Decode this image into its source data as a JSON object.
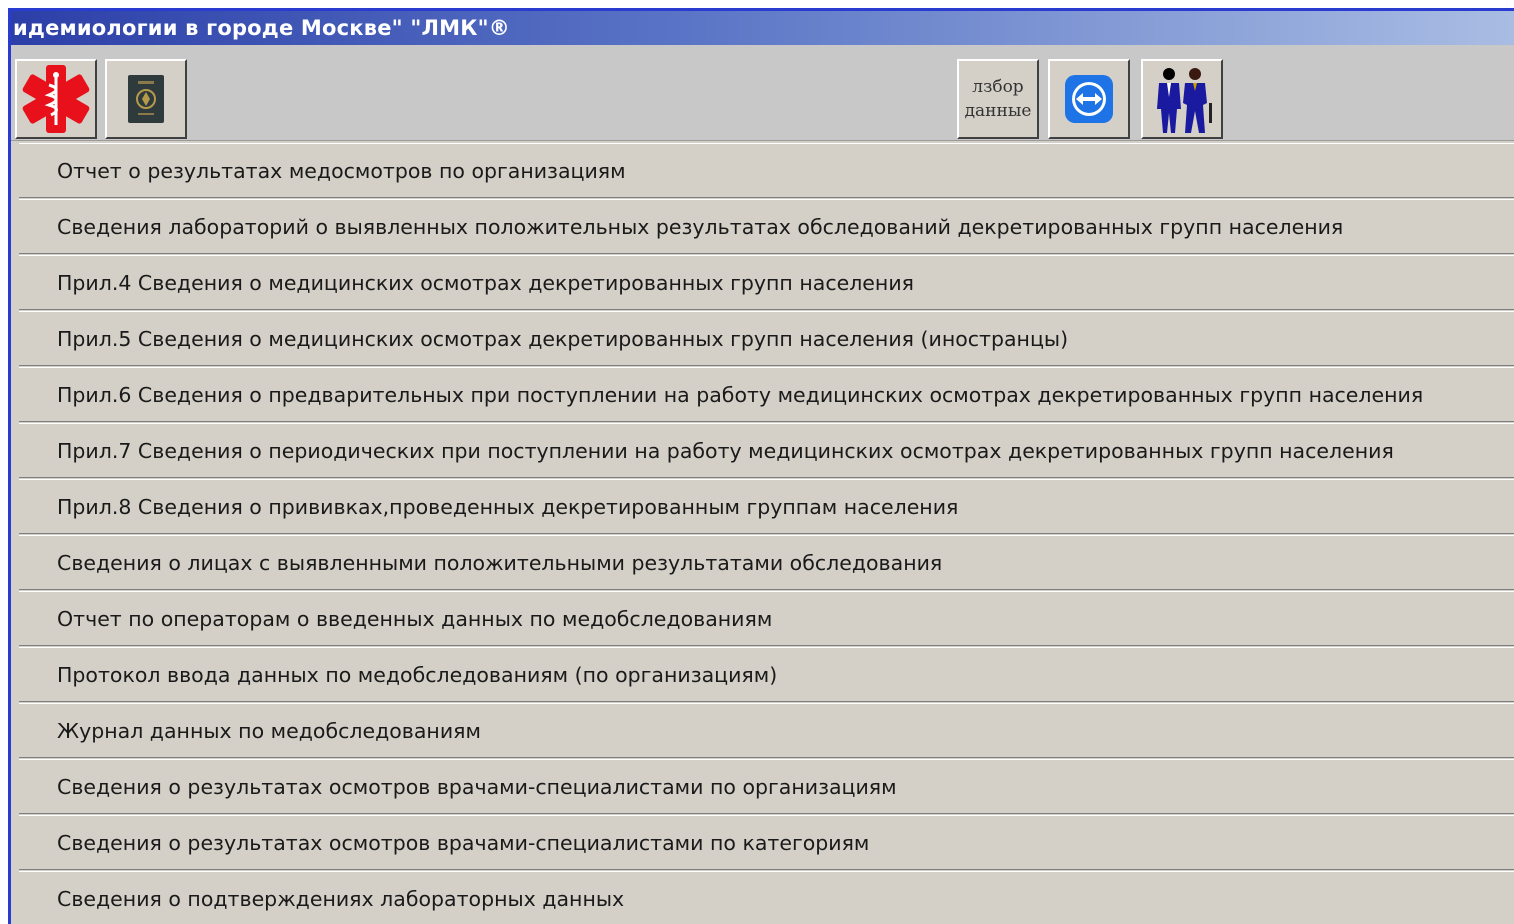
{
  "window": {
    "title": "идемиологии в городе Москве\" \"ЛМК\"®"
  },
  "toolbar": {
    "buttons": [
      {
        "icon": "medical-star-icon",
        "color": "#e8101b"
      },
      {
        "icon": "passport-icon",
        "color": "#2f3a3c"
      },
      {
        "icon": "text-button",
        "label_line1": "лзбор",
        "label_line2": "данные"
      },
      {
        "icon": "teamviewer-icon",
        "color": "#1e73e6"
      },
      {
        "icon": "people-icon",
        "color": "#1a1aa0"
      }
    ]
  },
  "menu": {
    "items": [
      "Отчет о результатах медосмотров по организациям",
      "Сведения лабораторий о выявленных положительных результатах обследований декретированных групп населения",
      "Прил.4 Сведения о медицинских осмотрах декретированных групп населения",
      "Прил.5 Сведения о медицинских осмотрах декретированных групп населения (иностранцы)",
      "Прил.6 Сведения о предварительных при поступлении на работу медицинских осмотрах декретированных групп населения",
      "Прил.7 Сведения о периодических при поступлении на работу медицинских осмотрах декретированных групп населения",
      "Прил.8 Сведения о прививках,проведенных декретированным группам населения",
      "Сведения о лицах с выявленными положительными результатами обследования",
      "Отчет по операторам о введенных данных по медобследованиям",
      "Протокол ввода данных по медобследованиям (по организациям)",
      "Журнал данных по медобследованиям",
      "Сведения о результатах осмотров врачами-специалистами по организациям",
      "Сведения о результатах осмотров врачами-специалистами по категориям",
      "Сведения о подтверждениях лабораторных данных"
    ]
  }
}
